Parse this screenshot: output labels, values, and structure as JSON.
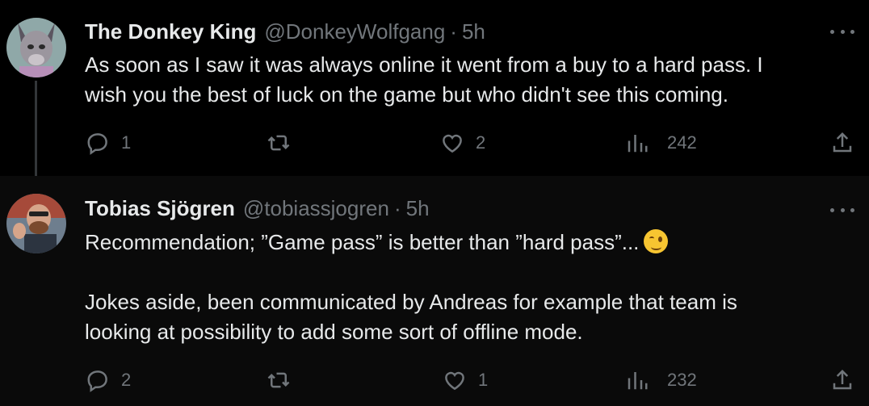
{
  "tweets": [
    {
      "name": "The Donkey King",
      "handle": "@DonkeyWolfgang",
      "sep": "·",
      "time": "5h",
      "text_lines": [
        "As soon as I saw it was always online it went from a buy to a hard pass. I",
        "wish you the best of luck on the game but who didn't see this coming."
      ],
      "replies": "1",
      "retweets": "",
      "likes": "2",
      "views": "242"
    },
    {
      "name": "Tobias Sjögren",
      "handle": "@tobiassjogren",
      "sep": "·",
      "time": "5h",
      "text_line1": "Recommendation; ”Game pass” is better than ”hard pass”...",
      "text_lines2": [
        "Jokes aside, been communicated by Andreas for example that team is",
        "looking at possibility to add some sort of offline mode."
      ],
      "replies": "2",
      "retweets": "",
      "likes": "1",
      "views": "232"
    }
  ],
  "icons": {
    "reply": "reply-icon",
    "retweet": "retweet-icon",
    "like": "heart-icon",
    "views": "views-icon",
    "share": "share-icon",
    "more": "more-icon",
    "emoji": "winking-face-emoji"
  },
  "colors": {
    "background": "#000000",
    "text": "#e7e9ea",
    "muted": "#71767b",
    "thread_line": "#333639"
  }
}
